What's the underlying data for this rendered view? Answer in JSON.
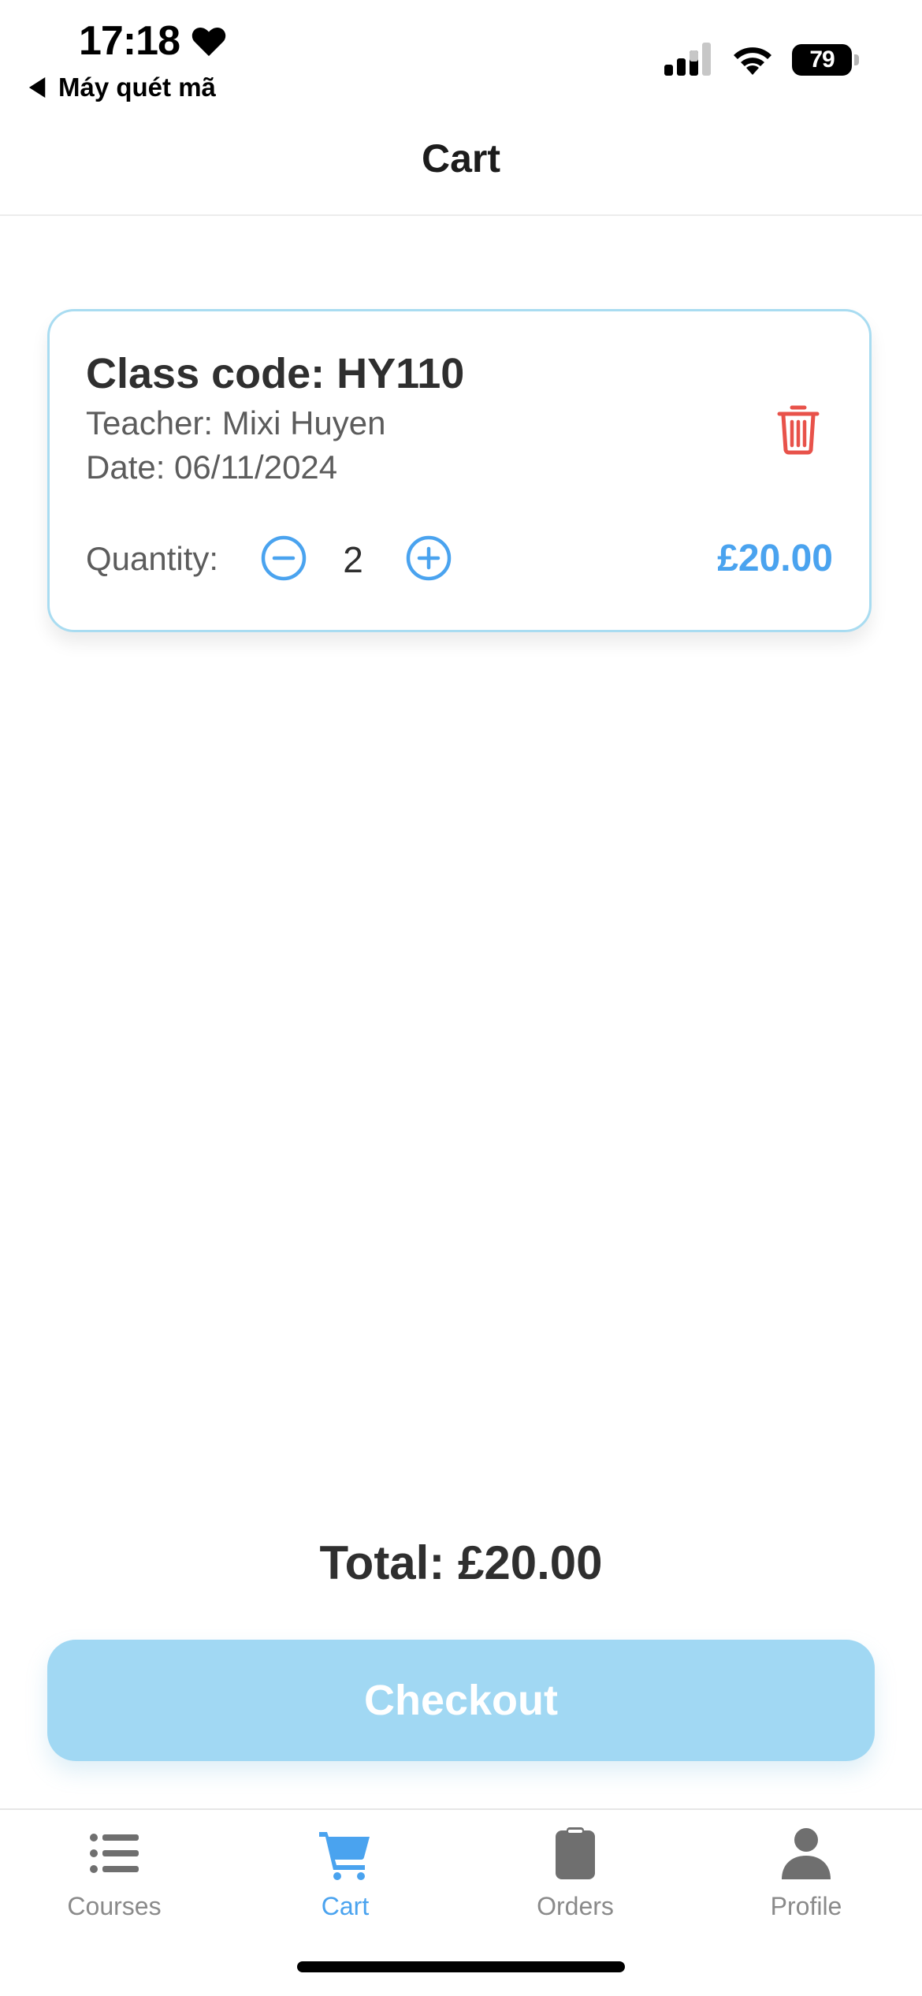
{
  "status_bar": {
    "time": "17:18",
    "back_app": "Máy quét mã",
    "battery": "79"
  },
  "header": {
    "title": "Cart"
  },
  "cart_items": [
    {
      "class_code": "Class code: HY110",
      "teacher": "Teacher: Mixi Huyen",
      "date": "Date: 06/11/2024",
      "quantity_label": "Quantity:",
      "quantity": "2",
      "price": "£20.00"
    }
  ],
  "summary": {
    "total": "Total: £20.00",
    "checkout_label": "Checkout"
  },
  "tabs": [
    {
      "label": "Courses",
      "icon": "list-icon",
      "active": false
    },
    {
      "label": "Cart",
      "icon": "cart-icon",
      "active": true
    },
    {
      "label": "Orders",
      "icon": "clipboard-icon",
      "active": false
    },
    {
      "label": "Profile",
      "icon": "person-icon",
      "active": false
    }
  ],
  "colors": {
    "accent": "#4aa3ef",
    "card_border": "#a9dcf1",
    "checkout_bg": "#a1d8f3",
    "delete": "#e8524a",
    "inactive_tab": "#8a8a8a"
  }
}
